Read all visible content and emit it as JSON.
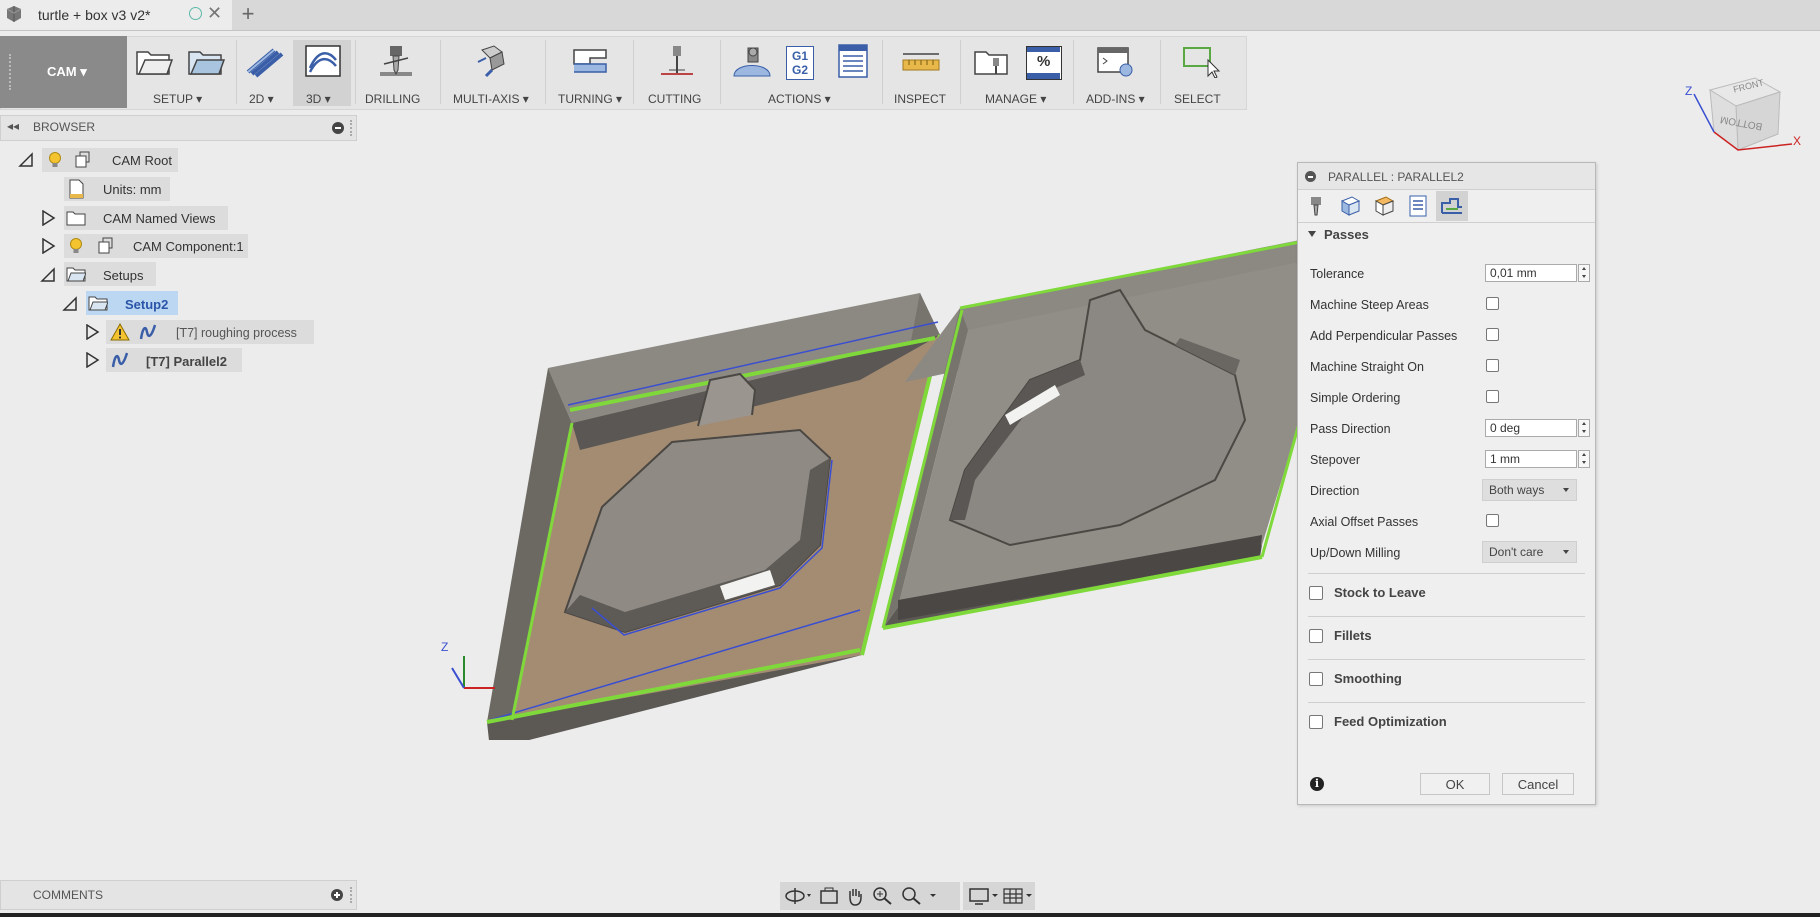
{
  "tab": {
    "title": "turtle + box v3 v2*",
    "close": "✕",
    "add": "+"
  },
  "workspace": {
    "label": "CAM ▾"
  },
  "toolbar": {
    "setup": "SETUP ▾",
    "two_d": "2D ▾",
    "three_d": "3D ▾",
    "drilling": "DRILLING",
    "multi_axis": "MULTI-AXIS ▾",
    "turning": "TURNING ▾",
    "cutting": "CUTTING",
    "actions": "ACTIONS ▾",
    "actions_g1g2_top": "G1",
    "actions_g1g2_bottom": "G2",
    "inspect": "INSPECT",
    "manage": "MANAGE ▾",
    "manage_pct": "%",
    "add_ins": "ADD-INS ▾",
    "select": "SELECT"
  },
  "browser": {
    "collapse": "◂◂",
    "title": "BROWSER",
    "items": [
      {
        "label": "CAM Root"
      },
      {
        "label": "Units: mm"
      },
      {
        "label": "CAM Named Views"
      },
      {
        "label": "CAM Component:1"
      },
      {
        "label": "Setups"
      },
      {
        "label": "Setup2"
      },
      {
        "label": "[T7] roughing process"
      },
      {
        "label": "[T7] Parallel2"
      }
    ]
  },
  "comments": {
    "title": "COMMENTS"
  },
  "viewcube": {
    "front": "FRONT",
    "bottom": "BOTTOM",
    "z": "Z",
    "x": "X"
  },
  "triad": {
    "z": "Z"
  },
  "dialog": {
    "title": "PARALLEL : PARALLEL2",
    "section": "Passes",
    "params": [
      {
        "label": "Tolerance",
        "value": "0,01 mm"
      },
      {
        "label": "Machine Steep Areas"
      },
      {
        "label": "Add Perpendicular Passes"
      },
      {
        "label": "Machine Straight On"
      },
      {
        "label": "Simple Ordering"
      },
      {
        "label": "Pass Direction",
        "value": "0 deg"
      },
      {
        "label": "Stepover",
        "value": "1 mm"
      },
      {
        "label": "Direction",
        "value": "Both ways"
      },
      {
        "label": "Axial Offset Passes"
      },
      {
        "label": "Up/Down Milling",
        "value": "Don't care"
      }
    ],
    "groups": [
      {
        "label": "Stock to Leave"
      },
      {
        "label": "Fillets"
      },
      {
        "label": "Smoothing"
      },
      {
        "label": "Feed Optimization"
      }
    ],
    "ok": "OK",
    "cancel": "Cancel",
    "info": "i"
  },
  "colors": {
    "accent_green": "#7fd93a",
    "selection_blue": "#bcd7f2",
    "toolpath_blue": "#3a4fd0"
  }
}
